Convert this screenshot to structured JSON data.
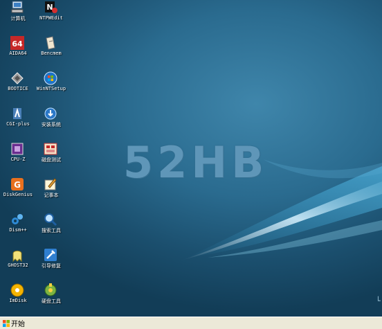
{
  "desktop": {
    "logo_text": "52HB",
    "icons": [
      {
        "label": "计算机",
        "icon": "computer-icon"
      },
      {
        "label": "NTPWEdit",
        "icon": "ntpwedit-icon"
      },
      {
        "label": "AIDA64",
        "icon": "aida64-icon"
      },
      {
        "label": "Bencmem",
        "icon": "bencmem-icon"
      },
      {
        "label": "BOOTICE",
        "icon": "bootice-icon"
      },
      {
        "label": "WinNTSetup",
        "icon": "winntsetup-icon"
      },
      {
        "label": "CGI-plus",
        "icon": "cgi-plus-icon"
      },
      {
        "label": "安装系统",
        "icon": "install-system-icon"
      },
      {
        "label": "CPU-Z",
        "icon": "cpu-z-icon"
      },
      {
        "label": "磁盘测试",
        "icon": "disk-test-icon"
      },
      {
        "label": "DiskGenius",
        "icon": "diskgenius-icon"
      },
      {
        "label": "记事本",
        "icon": "notepad-icon"
      },
      {
        "label": "Dism++",
        "icon": "dism-icon"
      },
      {
        "label": "搜索工具",
        "icon": "search-tool-icon"
      },
      {
        "label": "GHOST32",
        "icon": "ghost32-icon"
      },
      {
        "label": "引导修复",
        "icon": "boot-repair-icon"
      },
      {
        "label": "ImDisk",
        "icon": "imdisk-icon"
      },
      {
        "label": "硬盘工具",
        "icon": "hdd-tool-icon"
      }
    ]
  },
  "taskbar": {
    "start_label": "开始",
    "colors": {
      "bar": "#ece9d8",
      "wallpaper": "#1f5b7e"
    }
  }
}
